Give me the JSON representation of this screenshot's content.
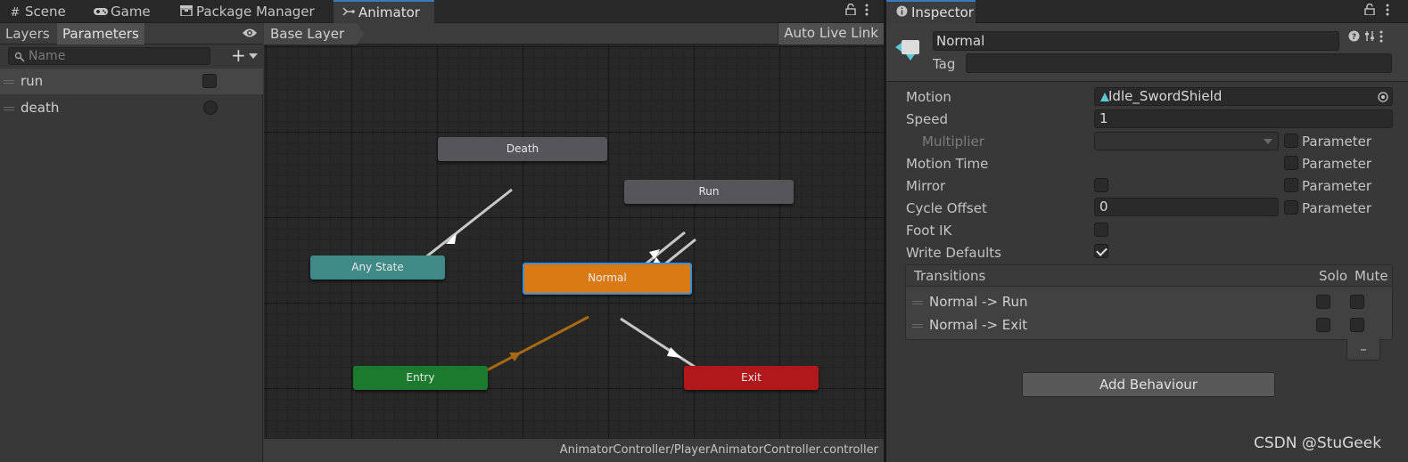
{
  "tabs_left": [
    {
      "label": "Scene",
      "icon": "scene-grid-icon"
    },
    {
      "label": "Game",
      "icon": "gamepad-icon"
    },
    {
      "label": "Package Manager",
      "icon": "package-icon"
    },
    {
      "label": "Animator",
      "icon": "animator-icon",
      "active": true
    }
  ],
  "left_panel": {
    "tabs": [
      "Layers",
      "Parameters"
    ],
    "active_tab": "Parameters",
    "search_placeholder": "Name",
    "parameters": [
      {
        "name": "run",
        "type": "bool",
        "value": false
      },
      {
        "name": "death",
        "type": "trigger",
        "value": false
      }
    ]
  },
  "graph": {
    "breadcrumb": "Base Layer",
    "auto_live_link": "Auto Live Link",
    "status_path": "AnimatorController/PlayerAnimatorController.controller",
    "states": [
      {
        "id": "death",
        "label": "Death",
        "color": "#55555a"
      },
      {
        "id": "run",
        "label": "Run",
        "color": "#55555a"
      },
      {
        "id": "any",
        "label": "Any State",
        "color": "#3f8a86"
      },
      {
        "id": "normal",
        "label": "Normal",
        "color": "#d97a12",
        "selected": true
      },
      {
        "id": "entry",
        "label": "Entry",
        "color": "#1b7a2e"
      },
      {
        "id": "exit",
        "label": "Exit",
        "color": "#b0181b"
      }
    ],
    "default_transition_color": "#a86a10",
    "transition_color": "#c8c8c8"
  },
  "inspector": {
    "tab": "Inspector",
    "state_name": "Normal",
    "tag_label": "Tag",
    "tag_value": "",
    "props": {
      "motion_label": "Motion",
      "motion_value": "Idle_SwordShield",
      "speed_label": "Speed",
      "speed_value": "1",
      "multiplier_label": "Multiplier",
      "motion_time_label": "Motion Time",
      "mirror_label": "Mirror",
      "cycle_offset_label": "Cycle Offset",
      "cycle_offset_value": "0",
      "foot_ik_label": "Foot IK",
      "write_defaults_label": "Write Defaults",
      "parameter_label": "Parameter"
    },
    "write_defaults": true,
    "transitions_header": "Transitions",
    "solo_label": "Solo",
    "mute_label": "Mute",
    "transitions": [
      "Normal -> Run",
      "Normal -> Exit"
    ],
    "remove_label": "–",
    "add_behaviour": "Add Behaviour"
  },
  "watermark": "CSDN @StuGeek"
}
